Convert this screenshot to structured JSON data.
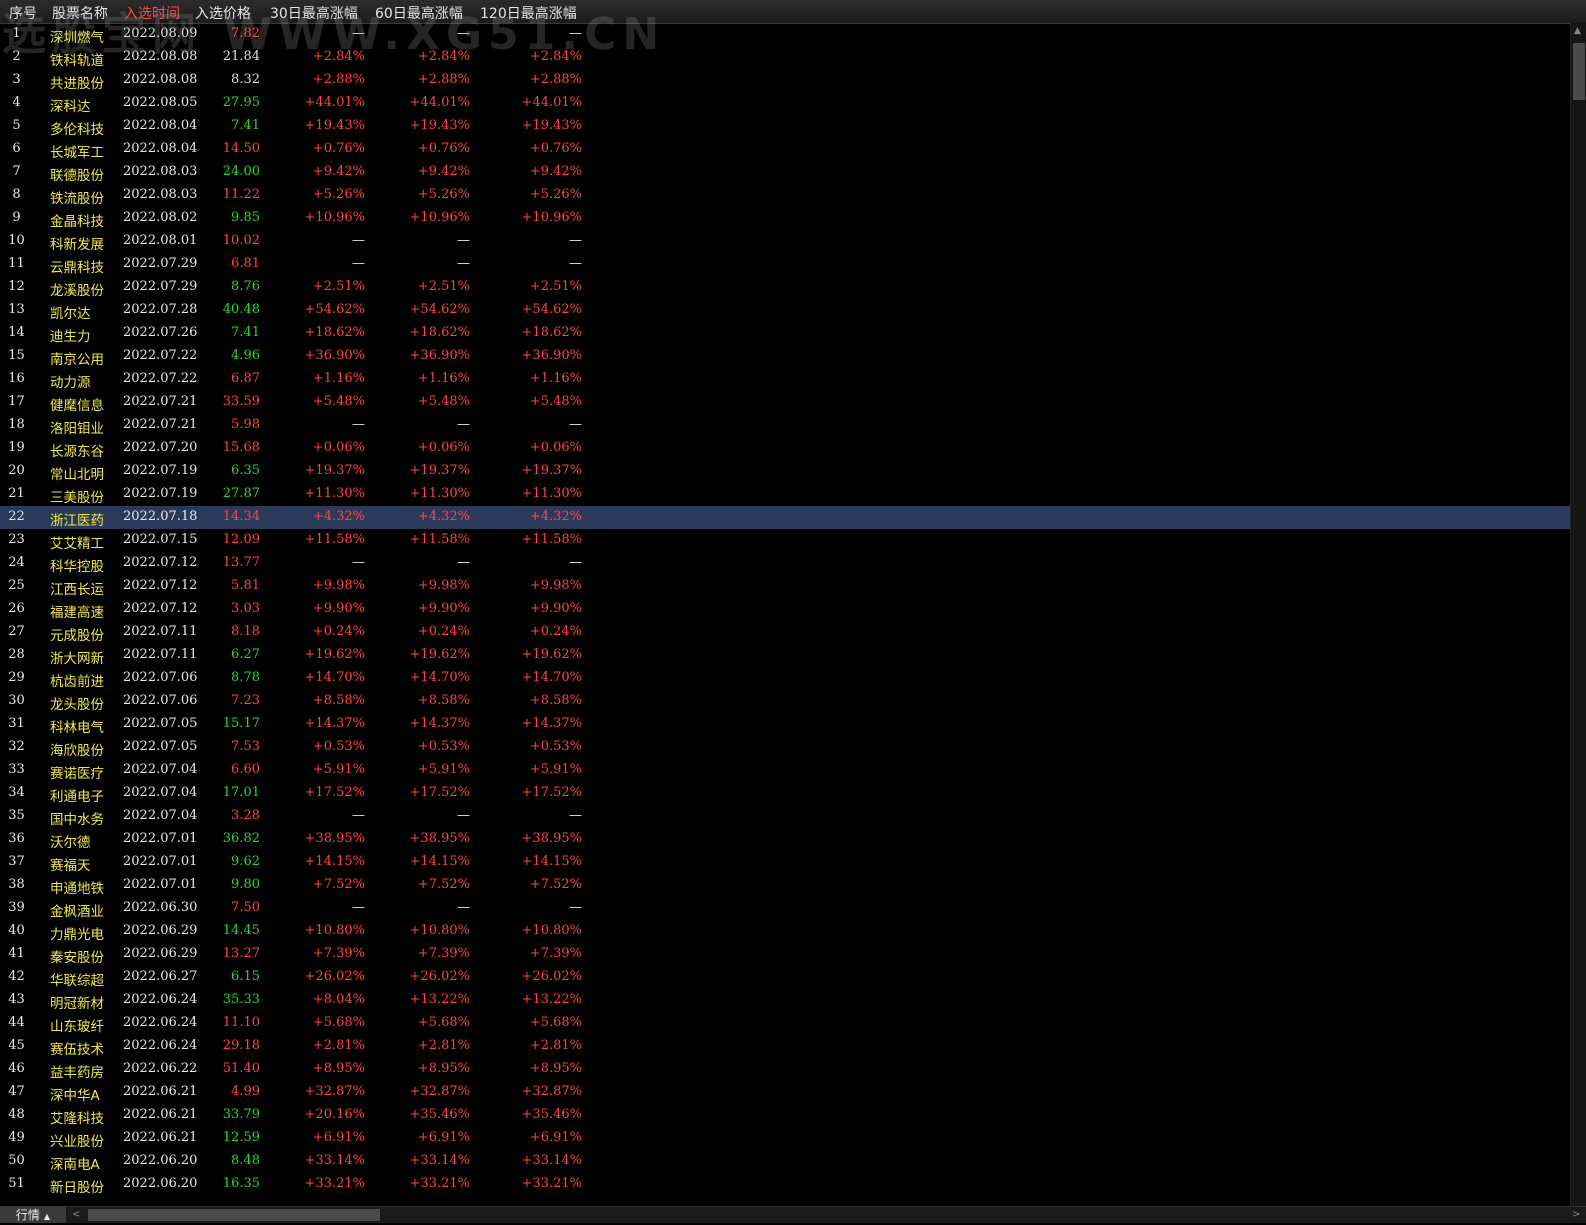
{
  "watermark": "选股宝网 WWW.XG51.CN",
  "header": {
    "idx": "序号",
    "name": "股票名称",
    "date": "入选时间",
    "price": "入选价格",
    "r30": "30日最高涨幅",
    "r60": "60日最高涨幅",
    "r120": "120日最高涨幅"
  },
  "colors": {
    "up": "#ff4444",
    "down": "#22dd22",
    "name": "#f1e84a",
    "selected_row": "#2b3a5a"
  },
  "selected_index": 21,
  "rows": [
    {
      "idx": "1",
      "name": "深圳燃气",
      "date": "2022.08.09",
      "price": "7.82",
      "dir": "up",
      "r30": "—",
      "r60": "—",
      "r120": "—"
    },
    {
      "idx": "2",
      "name": "铁科轨道",
      "date": "2022.08.08",
      "price": "21.84",
      "dir": "flat",
      "r30": "+2.84%",
      "r60": "+2.84%",
      "r120": "+2.84%"
    },
    {
      "idx": "3",
      "name": "共进股份",
      "date": "2022.08.08",
      "price": "8.32",
      "dir": "flat",
      "r30": "+2.88%",
      "r60": "+2.88%",
      "r120": "+2.88%"
    },
    {
      "idx": "4",
      "name": "深科达",
      "date": "2022.08.05",
      "price": "27.95",
      "dir": "down",
      "r30": "+44.01%",
      "r60": "+44.01%",
      "r120": "+44.01%"
    },
    {
      "idx": "5",
      "name": "多伦科技",
      "date": "2022.08.04",
      "price": "7.41",
      "dir": "down",
      "r30": "+19.43%",
      "r60": "+19.43%",
      "r120": "+19.43%"
    },
    {
      "idx": "6",
      "name": "长城军工",
      "date": "2022.08.04",
      "price": "14.50",
      "dir": "up",
      "r30": "+0.76%",
      "r60": "+0.76%",
      "r120": "+0.76%"
    },
    {
      "idx": "7",
      "name": "联德股份",
      "date": "2022.08.03",
      "price": "24.00",
      "dir": "down",
      "r30": "+9.42%",
      "r60": "+9.42%",
      "r120": "+9.42%"
    },
    {
      "idx": "8",
      "name": "铁流股份",
      "date": "2022.08.03",
      "price": "11.22",
      "dir": "up",
      "r30": "+5.26%",
      "r60": "+5.26%",
      "r120": "+5.26%"
    },
    {
      "idx": "9",
      "name": "金晶科技",
      "date": "2022.08.02",
      "price": "9.85",
      "dir": "down",
      "r30": "+10.96%",
      "r60": "+10.96%",
      "r120": "+10.96%"
    },
    {
      "idx": "10",
      "name": "科新发展",
      "date": "2022.08.01",
      "price": "10.02",
      "dir": "up",
      "r30": "—",
      "r60": "—",
      "r120": "—"
    },
    {
      "idx": "11",
      "name": "云鼎科技",
      "date": "2022.07.29",
      "price": "6.81",
      "dir": "up",
      "r30": "—",
      "r60": "—",
      "r120": "—"
    },
    {
      "idx": "12",
      "name": "龙溪股份",
      "date": "2022.07.29",
      "price": "8.76",
      "dir": "down",
      "r30": "+2.51%",
      "r60": "+2.51%",
      "r120": "+2.51%"
    },
    {
      "idx": "13",
      "name": "凯尔达",
      "date": "2022.07.28",
      "price": "40.48",
      "dir": "down",
      "r30": "+54.62%",
      "r60": "+54.62%",
      "r120": "+54.62%"
    },
    {
      "idx": "14",
      "name": "迪生力",
      "date": "2022.07.26",
      "price": "7.41",
      "dir": "down",
      "r30": "+18.62%",
      "r60": "+18.62%",
      "r120": "+18.62%"
    },
    {
      "idx": "15",
      "name": "南京公用",
      "date": "2022.07.22",
      "price": "4.96",
      "dir": "down",
      "r30": "+36.90%",
      "r60": "+36.90%",
      "r120": "+36.90%"
    },
    {
      "idx": "16",
      "name": "动力源",
      "date": "2022.07.22",
      "price": "6.87",
      "dir": "up",
      "r30": "+1.16%",
      "r60": "+1.16%",
      "r120": "+1.16%"
    },
    {
      "idx": "17",
      "name": "健麾信息",
      "date": "2022.07.21",
      "price": "33.59",
      "dir": "up",
      "r30": "+5.48%",
      "r60": "+5.48%",
      "r120": "+5.48%"
    },
    {
      "idx": "18",
      "name": "洛阳钼业",
      "date": "2022.07.21",
      "price": "5.98",
      "dir": "up",
      "r30": "—",
      "r60": "—",
      "r120": "—"
    },
    {
      "idx": "19",
      "name": "长源东谷",
      "date": "2022.07.20",
      "price": "15.68",
      "dir": "up",
      "r30": "+0.06%",
      "r60": "+0.06%",
      "r120": "+0.06%"
    },
    {
      "idx": "20",
      "name": "常山北明",
      "date": "2022.07.19",
      "price": "6.35",
      "dir": "down",
      "r30": "+19.37%",
      "r60": "+19.37%",
      "r120": "+19.37%"
    },
    {
      "idx": "21",
      "name": "三美股份",
      "date": "2022.07.19",
      "price": "27.87",
      "dir": "down",
      "r30": "+11.30%",
      "r60": "+11.30%",
      "r120": "+11.30%"
    },
    {
      "idx": "22",
      "name": "浙江医药",
      "date": "2022.07.18",
      "price": "14.34",
      "dir": "up",
      "r30": "+4.32%",
      "r60": "+4.32%",
      "r120": "+4.32%"
    },
    {
      "idx": "23",
      "name": "艾艾精工",
      "date": "2022.07.15",
      "price": "12.09",
      "dir": "up",
      "r30": "+11.58%",
      "r60": "+11.58%",
      "r120": "+11.58%"
    },
    {
      "idx": "24",
      "name": "科华控股",
      "date": "2022.07.12",
      "price": "13.77",
      "dir": "up",
      "r30": "—",
      "r60": "—",
      "r120": "—"
    },
    {
      "idx": "25",
      "name": "江西长运",
      "date": "2022.07.12",
      "price": "5.81",
      "dir": "up",
      "r30": "+9.98%",
      "r60": "+9.98%",
      "r120": "+9.98%"
    },
    {
      "idx": "26",
      "name": "福建高速",
      "date": "2022.07.12",
      "price": "3.03",
      "dir": "up",
      "r30": "+9.90%",
      "r60": "+9.90%",
      "r120": "+9.90%"
    },
    {
      "idx": "27",
      "name": "元成股份",
      "date": "2022.07.11",
      "price": "8.18",
      "dir": "up",
      "r30": "+0.24%",
      "r60": "+0.24%",
      "r120": "+0.24%"
    },
    {
      "idx": "28",
      "name": "浙大网新",
      "date": "2022.07.11",
      "price": "6.27",
      "dir": "down",
      "r30": "+19.62%",
      "r60": "+19.62%",
      "r120": "+19.62%"
    },
    {
      "idx": "29",
      "name": "杭齿前进",
      "date": "2022.07.06",
      "price": "8.78",
      "dir": "down",
      "r30": "+14.70%",
      "r60": "+14.70%",
      "r120": "+14.70%"
    },
    {
      "idx": "30",
      "name": "龙头股份",
      "date": "2022.07.06",
      "price": "7.23",
      "dir": "up",
      "r30": "+8.58%",
      "r60": "+8.58%",
      "r120": "+8.58%"
    },
    {
      "idx": "31",
      "name": "科林电气",
      "date": "2022.07.05",
      "price": "15.17",
      "dir": "down",
      "r30": "+14.37%",
      "r60": "+14.37%",
      "r120": "+14.37%"
    },
    {
      "idx": "32",
      "name": "海欣股份",
      "date": "2022.07.05",
      "price": "7.53",
      "dir": "up",
      "r30": "+0.53%",
      "r60": "+0.53%",
      "r120": "+0.53%"
    },
    {
      "idx": "33",
      "name": "赛诺医疗",
      "date": "2022.07.04",
      "price": "6.60",
      "dir": "up",
      "r30": "+5.91%",
      "r60": "+5.91%",
      "r120": "+5.91%"
    },
    {
      "idx": "34",
      "name": "利通电子",
      "date": "2022.07.04",
      "price": "17.01",
      "dir": "down",
      "r30": "+17.52%",
      "r60": "+17.52%",
      "r120": "+17.52%"
    },
    {
      "idx": "35",
      "name": "国中水务",
      "date": "2022.07.04",
      "price": "3.28",
      "dir": "up",
      "r30": "—",
      "r60": "—",
      "r120": "—"
    },
    {
      "idx": "36",
      "name": "沃尔德",
      "date": "2022.07.01",
      "price": "36.82",
      "dir": "down",
      "r30": "+38.95%",
      "r60": "+38.95%",
      "r120": "+38.95%"
    },
    {
      "idx": "37",
      "name": "赛福天",
      "date": "2022.07.01",
      "price": "9.62",
      "dir": "down",
      "r30": "+14.15%",
      "r60": "+14.15%",
      "r120": "+14.15%"
    },
    {
      "idx": "38",
      "name": "申通地铁",
      "date": "2022.07.01",
      "price": "9.80",
      "dir": "down",
      "r30": "+7.52%",
      "r60": "+7.52%",
      "r120": "+7.52%"
    },
    {
      "idx": "39",
      "name": "金枫酒业",
      "date": "2022.06.30",
      "price": "7.50",
      "dir": "up",
      "r30": "—",
      "r60": "—",
      "r120": "—"
    },
    {
      "idx": "40",
      "name": "力鼎光电",
      "date": "2022.06.29",
      "price": "14.45",
      "dir": "down",
      "r30": "+10.80%",
      "r60": "+10.80%",
      "r120": "+10.80%"
    },
    {
      "idx": "41",
      "name": "秦安股份",
      "date": "2022.06.29",
      "price": "13.27",
      "dir": "up",
      "r30": "+7.39%",
      "r60": "+7.39%",
      "r120": "+7.39%"
    },
    {
      "idx": "42",
      "name": "华联综超",
      "date": "2022.06.27",
      "price": "6.15",
      "dir": "down",
      "r30": "+26.02%",
      "r60": "+26.02%",
      "r120": "+26.02%"
    },
    {
      "idx": "43",
      "name": "明冠新材",
      "date": "2022.06.24",
      "price": "35.33",
      "dir": "down",
      "r30": "+8.04%",
      "r60": "+13.22%",
      "r120": "+13.22%"
    },
    {
      "idx": "44",
      "name": "山东玻纤",
      "date": "2022.06.24",
      "price": "11.10",
      "dir": "up",
      "r30": "+5.68%",
      "r60": "+5.68%",
      "r120": "+5.68%"
    },
    {
      "idx": "45",
      "name": "赛伍技术",
      "date": "2022.06.24",
      "price": "29.18",
      "dir": "up",
      "r30": "+2.81%",
      "r60": "+2.81%",
      "r120": "+2.81%"
    },
    {
      "idx": "46",
      "name": "益丰药房",
      "date": "2022.06.22",
      "price": "51.40",
      "dir": "up",
      "r30": "+8.95%",
      "r60": "+8.95%",
      "r120": "+8.95%"
    },
    {
      "idx": "47",
      "name": "深中华A",
      "date": "2022.06.21",
      "price": "4.99",
      "dir": "up",
      "r30": "+32.87%",
      "r60": "+32.87%",
      "r120": "+32.87%"
    },
    {
      "idx": "48",
      "name": "艾隆科技",
      "date": "2022.06.21",
      "price": "33.79",
      "dir": "down",
      "r30": "+20.16%",
      "r60": "+35.46%",
      "r120": "+35.46%"
    },
    {
      "idx": "49",
      "name": "兴业股份",
      "date": "2022.06.21",
      "price": "12.59",
      "dir": "down",
      "r30": "+6.91%",
      "r60": "+6.91%",
      "r120": "+6.91%"
    },
    {
      "idx": "50",
      "name": "深南电A",
      "date": "2022.06.20",
      "price": "8.48",
      "dir": "down",
      "r30": "+33.14%",
      "r60": "+33.14%",
      "r120": "+33.14%"
    },
    {
      "idx": "51",
      "name": "新日股份",
      "date": "2022.06.20",
      "price": "16.35",
      "dir": "down",
      "r30": "+33.21%",
      "r60": "+33.21%",
      "r120": "+33.21%"
    }
  ],
  "bottom": {
    "tab_label": "行情"
  }
}
